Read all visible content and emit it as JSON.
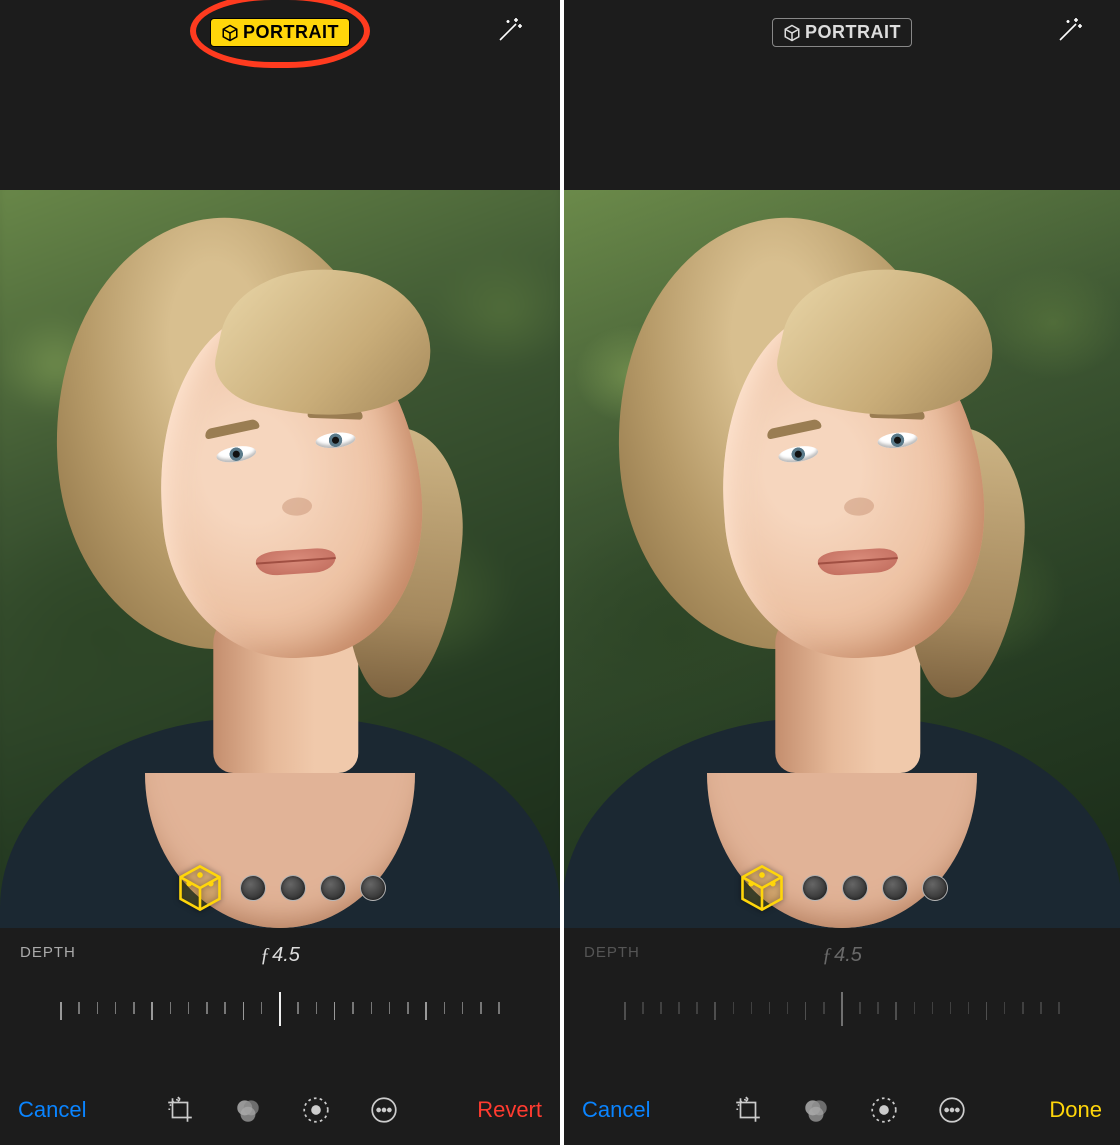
{
  "panes": {
    "left": {
      "badge_label": "PORTRAIT",
      "badge_state": "active",
      "annotation_circle": true,
      "depth": {
        "label": "DEPTH",
        "value": "4.5",
        "dim": false
      },
      "toolbar": {
        "cancel": "Cancel",
        "action": "Revert",
        "action_kind": "revert"
      }
    },
    "right": {
      "badge_label": "PORTRAIT",
      "badge_state": "inactive",
      "annotation_circle": false,
      "depth": {
        "label": "DEPTH",
        "value": "4.5",
        "dim": true
      },
      "toolbar": {
        "cancel": "Cancel",
        "action": "Done",
        "action_kind": "done"
      }
    }
  },
  "lighting_options": [
    "natural",
    "studio",
    "contour",
    "stage",
    "stage-mono"
  ],
  "toolbar_tools": [
    "crop",
    "filters",
    "adjust",
    "more"
  ],
  "colors": {
    "accent_yellow": "#ffd60a",
    "ios_blue": "#0a84ff",
    "ios_red": "#ff3b30",
    "annotation": "#ff3b1f"
  }
}
